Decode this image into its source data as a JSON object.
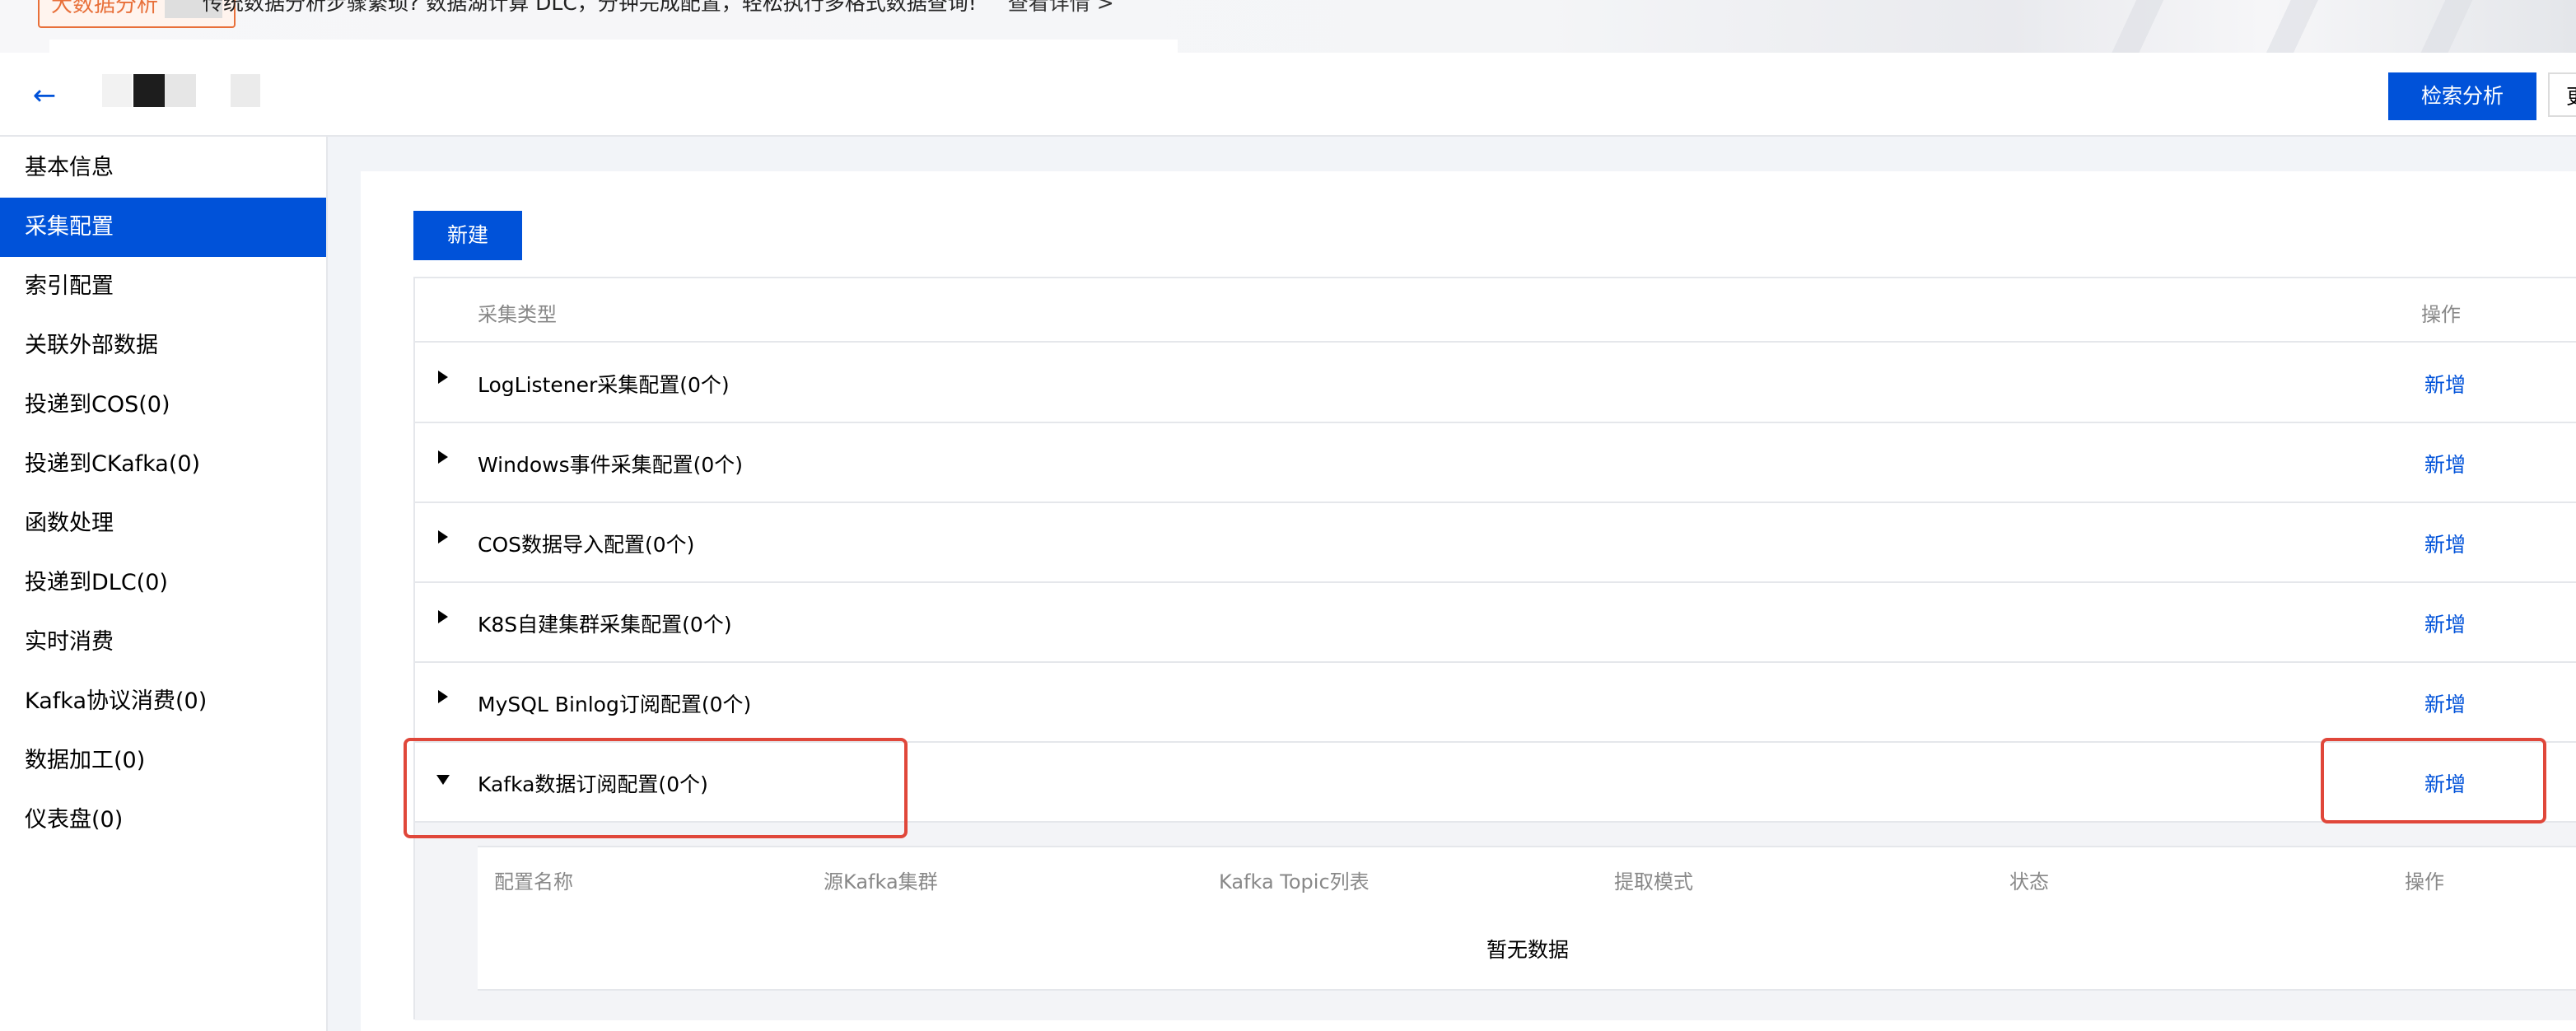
{
  "banner": {
    "tag_label": "大数据分析",
    "text": "传统数据分析步骤繁琐? 数据湖计算 DLC，分钟完成配置，轻松执行多格式数据查询!",
    "link": "查看详情 >"
  },
  "header": {
    "back_icon": "arrow-left-icon",
    "search_analysis_label": "检索分析",
    "more_label": "更"
  },
  "sidebar": {
    "items": [
      {
        "label": "基本信息"
      },
      {
        "label": "采集配置"
      },
      {
        "label": "索引配置"
      },
      {
        "label": "关联外部数据"
      },
      {
        "label": "投递到COS(0)"
      },
      {
        "label": "投递到CKafka(0)"
      },
      {
        "label": "函数处理"
      },
      {
        "label": "投递到DLC(0)"
      },
      {
        "label": "实时消费"
      },
      {
        "label": "Kafka协议消费(0)"
      },
      {
        "label": "数据加工(0)"
      },
      {
        "label": "仪表盘(0)"
      }
    ],
    "active_index": 1
  },
  "main": {
    "new_button_label": "新建",
    "table": {
      "col_type": "采集类型",
      "col_op": "操作",
      "rows": [
        {
          "name": "LogListener采集配置(0个)",
          "action": "新增",
          "expanded": false
        },
        {
          "name": "Windows事件采集配置(0个)",
          "action": "新增",
          "expanded": false
        },
        {
          "name": "COS数据导入配置(0个)",
          "action": "新增",
          "expanded": false
        },
        {
          "name": "K8S自建集群采集配置(0个)",
          "action": "新增",
          "expanded": false
        },
        {
          "name": "MySQL Binlog订阅配置(0个)",
          "action": "新增",
          "expanded": false
        },
        {
          "name": "Kafka数据订阅配置(0个)",
          "action": "新增",
          "expanded": true
        }
      ]
    },
    "subtable": {
      "columns": [
        "配置名称",
        "源Kafka集群",
        "Kafka Topic列表",
        "提取模式",
        "状态",
        "操作"
      ],
      "empty_text": "暂无数据"
    }
  },
  "colors": {
    "primary": "#0052d9",
    "highlight": "#e0473a"
  }
}
